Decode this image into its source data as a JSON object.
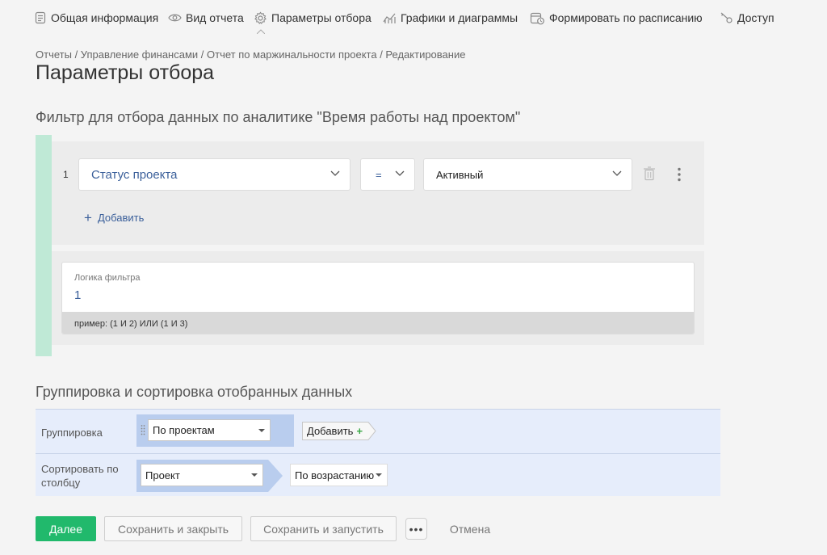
{
  "nav": {
    "items": [
      {
        "label": "Общая информация",
        "icon": "document-icon"
      },
      {
        "label": "Вид отчета",
        "icon": "eye-icon"
      },
      {
        "label": "Параметры отбора",
        "icon": "gear-icon"
      },
      {
        "label": "Графики и диаграммы",
        "icon": "chart-icon"
      },
      {
        "label": "Формировать по расписанию",
        "icon": "calendar-clock-icon"
      },
      {
        "label": "Доступ",
        "icon": "key-icon"
      }
    ]
  },
  "breadcrumb": [
    "Отчеты",
    "Управление финансами",
    "Отчет по маржинальности проекта",
    "Редактирование"
  ],
  "breadcrumb_sep": "/",
  "page_title": "Параметры отбора",
  "filter": {
    "title": "Фильтр для отбора данных по аналитике \"Время работы над проектом\"",
    "rows": [
      {
        "num": "1",
        "field": "Статус проекта",
        "operator": "=",
        "value": "Активный"
      }
    ],
    "add_label": "Добавить",
    "logic_label": "Логика фильтра",
    "logic_value": "1",
    "logic_hint": "пример: (1 И 2) ИЛИ (1 И 3)"
  },
  "grouping": {
    "title": "Группировка и сортировка отобранных данных",
    "group_label": "Группировка",
    "group_value": "По проектам",
    "add_label": "Добавить",
    "sort_label_line1": "Сортировать по",
    "sort_label_line2": "столбцу",
    "sort_column": "Проект",
    "sort_order": "По возрастанию"
  },
  "buttons": {
    "next": "Далее",
    "save_close": "Сохранить и закрыть",
    "save_run": "Сохранить и запустить",
    "more": "•••",
    "cancel": "Отмена"
  },
  "colors": {
    "primary": "#21b96c",
    "accent_bar": "#bfe9d6",
    "link": "#3a5f9a",
    "group_bg": "#e6edfb",
    "group_block": "#b9cdee"
  }
}
